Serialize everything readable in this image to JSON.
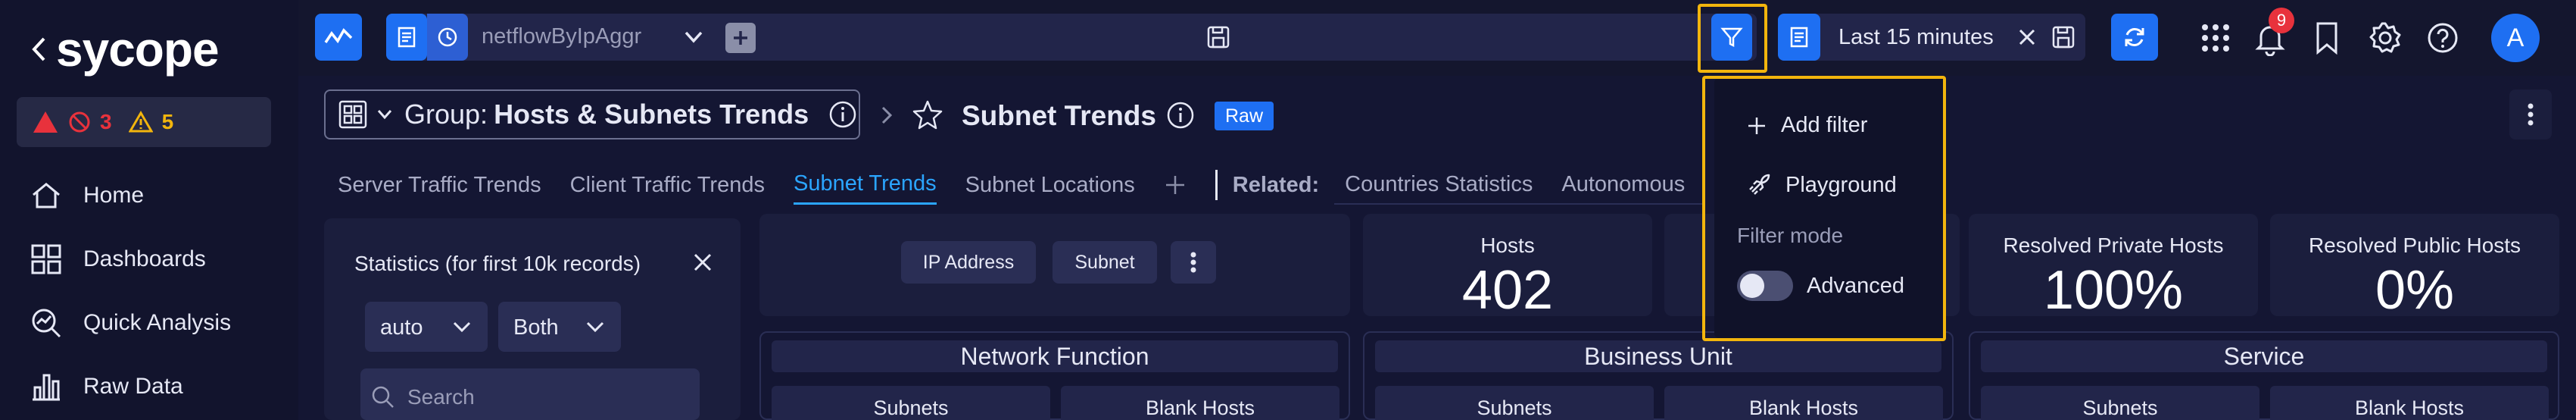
{
  "sidebar": {
    "logo": "sycope",
    "alerts": {
      "critical": "3",
      "warning": "5"
    },
    "nav": [
      {
        "label": "Home",
        "icon": "home-icon"
      },
      {
        "label": "Dashboards",
        "icon": "dashboards-icon"
      },
      {
        "label": "Quick Analysis",
        "icon": "quick-analysis-icon"
      },
      {
        "label": "Raw Data",
        "icon": "raw-data-icon"
      }
    ]
  },
  "toolbar": {
    "query_name": "netflowByIpAggr",
    "time_range": "Last 15 minutes",
    "notification_count": "9",
    "user_initial": "A"
  },
  "header": {
    "group_prefix": "Group:",
    "group_name": "Hosts & Subnets Trends",
    "page_title": "Subnet Trends",
    "raw_badge": "Raw"
  },
  "tabs": [
    "Server Traffic Trends",
    "Client Traffic Trends",
    "Subnet Trends",
    "Subnet Locations"
  ],
  "active_tab": "Subnet Trends",
  "related": {
    "label": "Related:",
    "items": [
      "Countries Statistics",
      "Autonomous"
    ]
  },
  "stats_panel": {
    "title": "Statistics (for first 10k records)",
    "select_1": "auto",
    "select_2": "Both",
    "search_placeholder": "Search"
  },
  "chips": [
    "IP Address",
    "Subnet"
  ],
  "kpis": [
    {
      "title": "Hosts",
      "value": "402"
    },
    {
      "title": "Resolved Private Hosts",
      "value": "100%"
    },
    {
      "title": "Resolved Public Hosts",
      "value": "0%"
    }
  ],
  "sections": [
    {
      "title": "Network Function",
      "cols": [
        "Subnets",
        "Blank Hosts"
      ]
    },
    {
      "title": "Business Unit",
      "cols": [
        "Subnets",
        "Blank Hosts"
      ]
    },
    {
      "title": "Service",
      "cols": [
        "Subnets",
        "Blank Hosts"
      ]
    }
  ],
  "filter_menu": {
    "add_filter": "Add filter",
    "playground": "Playground",
    "mode_label": "Filter mode",
    "advanced": "Advanced",
    "advanced_enabled": false
  },
  "colors": {
    "accent": "#1e6ff2",
    "highlight": "#f2b50d",
    "active_tab": "#2ba5ff",
    "critical": "#e8323c",
    "warning": "#f2b50d"
  }
}
